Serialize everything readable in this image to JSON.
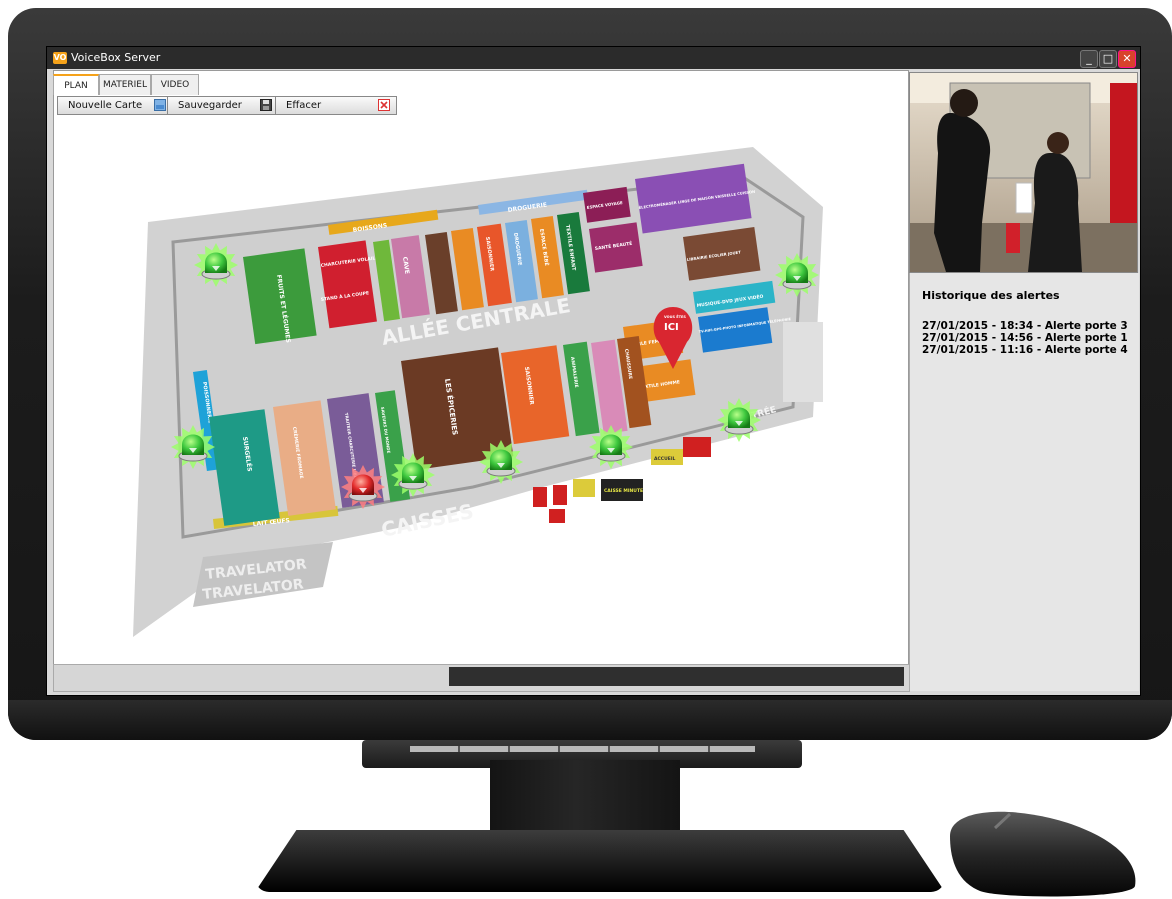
{
  "window": {
    "title": "VoiceBox Server",
    "logo_text": "VO"
  },
  "window_controls": {
    "minimize": "_",
    "maximize": "□",
    "close": "✕"
  },
  "tabs": [
    {
      "label": "PLAN",
      "active": true
    },
    {
      "label": "MATERIEL",
      "active": false
    },
    {
      "label": "VIDEO",
      "active": false
    }
  ],
  "toolbar": {
    "new_map_label": "Nouvelle Carte",
    "save_label": "Sauvegarder",
    "clear_label": "Effacer"
  },
  "map": {
    "labels": {
      "allee": "ALLÉE CENTRALE",
      "caisses": "CAISSES",
      "travelator": "TRAVELATOR",
      "entree": "ENTRÉE",
      "ici_top": "VOUS ÊTES",
      "ici": "ICI",
      "boissons": "BOISSONS",
      "droguerie_top": "DROGUERIE",
      "lait_oeufs": "LAIT ŒUFS",
      "poissonnerie": "POISSONNERIE",
      "fruits": "FRUITS ET LÉGUMES",
      "charcuterie": "CHARCUTERIE VOLAILLE",
      "stand": "STAND À LA COUPE",
      "cave": "CAVE",
      "saisonnier": "SAISONNIER",
      "droguerie": "DROGUERIE",
      "espace_bebe": "ESPACE BÉBÉ",
      "textile_enfant": "TEXTILE ENFANT",
      "espace_voyage": "ESPACE VOYAGE",
      "sante_beaute": "SANTÉ BEAUTÉ",
      "electromenager": "ÉLECTROMÉNAGER LINGE DE MAISON VAISSELLE CUISSON",
      "librairie": "LIBRAIRIE ÉCOLIER JOUET",
      "musique": "MUSIQUE-DVD JEUX VIDÉO",
      "tv_hifi": "TV-HIFI-GPS-PHOTO INFORMATIQUE TÉLÉPHONIE",
      "textile_femme": "TEXTILE FEMME",
      "textile_homme": "TEXTILE HOMME",
      "chaussure": "CHAUSSURE",
      "animalerie": "ANIMALERIE",
      "surgeles": "SURGELÉS",
      "cremerie": "CRÈMERIE FROMAGE",
      "traiteur": "TRAITEUR CHARCUTERIE LIBRE SERVICE",
      "saveurs": "SAVEURS DU MONDE",
      "epiceries": "LES ÉPICERIES",
      "saisonnier2": "SAISONNIER",
      "caisse_minute": "CAISSE MINUTE",
      "accueil": "ACCUEIL"
    },
    "alarms": [
      {
        "id": "alarm-nw",
        "status": "ok"
      },
      {
        "id": "alarm-ne",
        "status": "ok"
      },
      {
        "id": "alarm-w",
        "status": "ok"
      },
      {
        "id": "alarm-se",
        "status": "ok"
      },
      {
        "id": "alarm-caisse-1",
        "status": "alert"
      },
      {
        "id": "alarm-caisse-2",
        "status": "ok"
      },
      {
        "id": "alarm-caisse-3",
        "status": "ok"
      },
      {
        "id": "alarm-caisse-4",
        "status": "ok"
      }
    ],
    "colors": {
      "ok": "#2fb52f",
      "alert": "#d62020",
      "floor": "#c9c9c9"
    }
  },
  "alerts": {
    "title": "Historique des alertes",
    "items": [
      "27/01/2015 - 18:34 - Alerte porte 3",
      "27/01/2015 - 14:56 - Alerte porte 1",
      "27/01/2015 - 11:16 - Alerte porte 4"
    ]
  }
}
